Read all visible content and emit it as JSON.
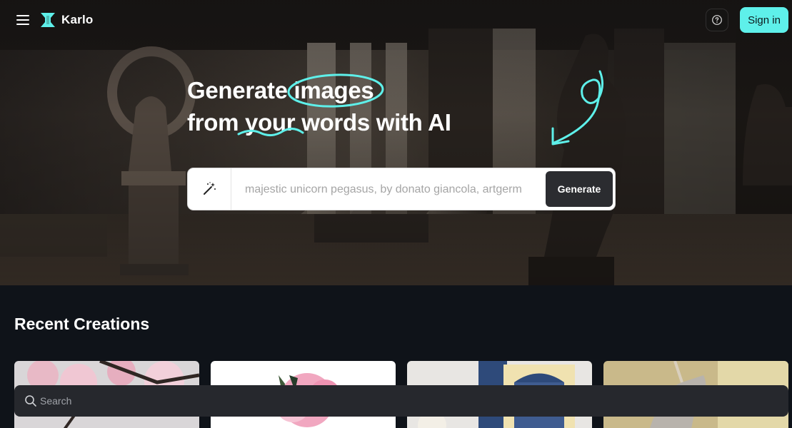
{
  "header": {
    "brand": "Karlo",
    "sign_in_label": "Sign in",
    "accent_color": "#5ef0ea"
  },
  "hero": {
    "headline_line1_a": "Generate ",
    "headline_line1_b": "images",
    "headline_line2_a": "from ",
    "headline_line2_b": "your",
    "headline_line2_c": " words with AI"
  },
  "prompt": {
    "placeholder": "majestic unicorn pegasus, by donato giancola, artgerm",
    "generate_label": "Generate"
  },
  "recent": {
    "title": "Recent Creations",
    "cards": [
      {
        "name": "cherry-blossom-image"
      },
      {
        "name": "pink-flowers-image"
      },
      {
        "name": "blue-window-image"
      },
      {
        "name": "unicorn-image"
      }
    ]
  },
  "search": {
    "placeholder": "Search"
  },
  "icons": {
    "menu": "hamburger-icon",
    "logo": "karlo-logo-icon",
    "help": "help-circle-icon",
    "wand": "magic-wand-icon",
    "search": "search-icon"
  }
}
